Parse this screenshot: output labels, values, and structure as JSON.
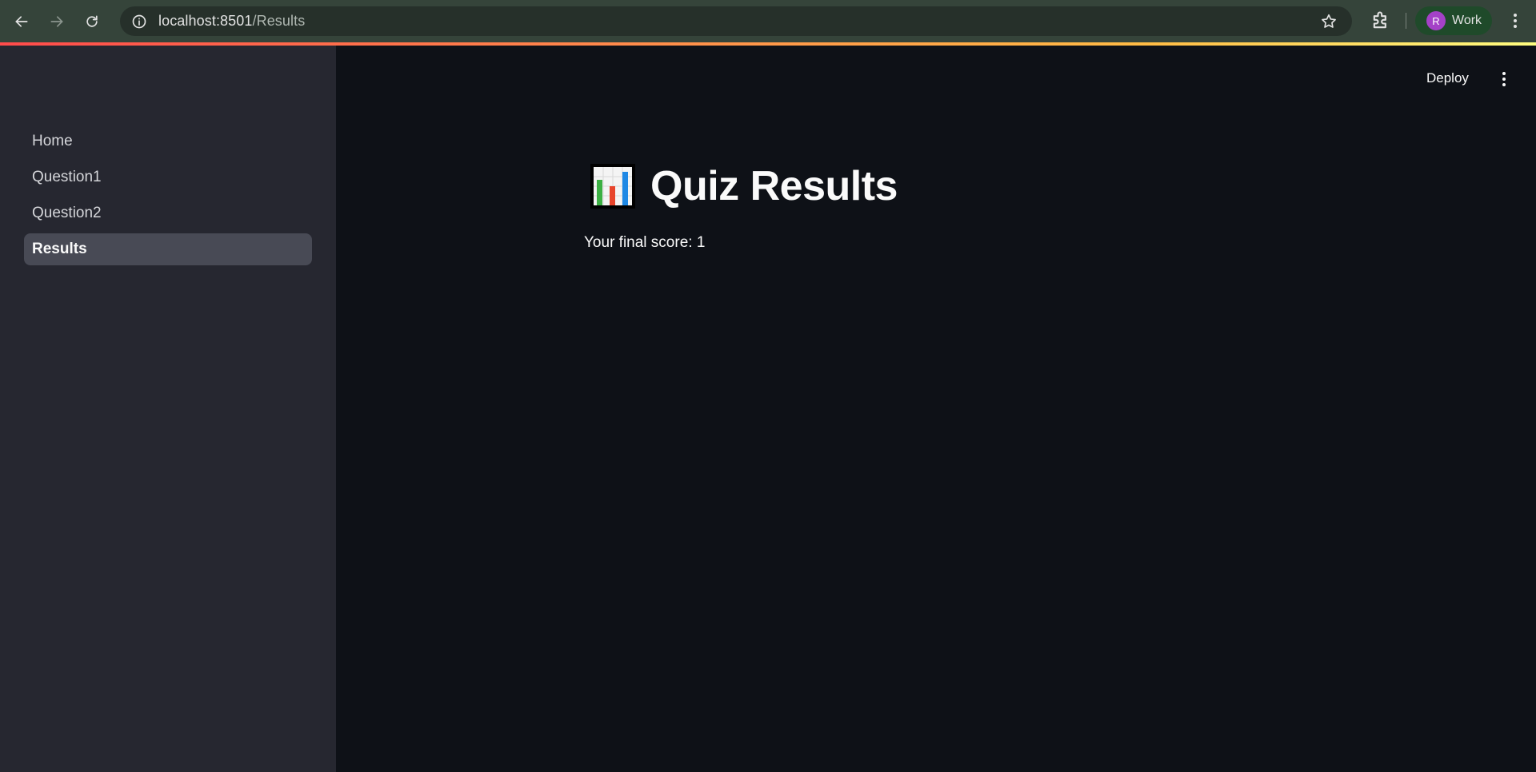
{
  "browser": {
    "url_host": "localhost:8501",
    "url_path": "/Results",
    "profile_initial": "R",
    "profile_label": "Work"
  },
  "sidebar": {
    "items": [
      {
        "label": "Home",
        "active": false
      },
      {
        "label": "Question1",
        "active": false
      },
      {
        "label": "Question2",
        "active": false
      },
      {
        "label": "Results",
        "active": true
      }
    ]
  },
  "header": {
    "deploy_label": "Deploy"
  },
  "main": {
    "title": "Quiz Results",
    "title_icon": "bar-chart-icon",
    "score_text": "Your final score: 1"
  },
  "colors": {
    "sidebar_bg": "#262730",
    "main_bg": "#0e1117",
    "active_item_bg": "#484a55",
    "browser_toolbar": "#35443a"
  }
}
